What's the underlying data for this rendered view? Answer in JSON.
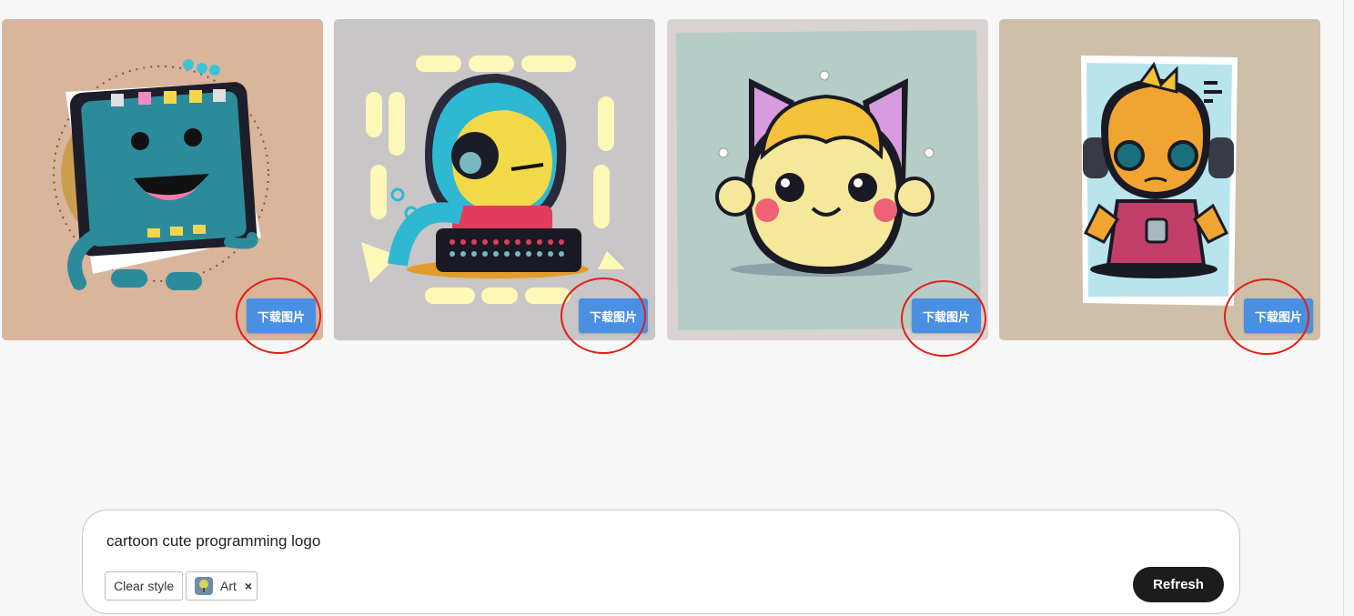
{
  "gallery": {
    "cards": [
      {
        "download_label": "下载图片",
        "bg": "#d9b59c"
      },
      {
        "download_label": "下载图片",
        "bg": "#c8c6c6"
      },
      {
        "download_label": "下载图片",
        "bg": "#d8d3d1"
      },
      {
        "download_label": "下载图片",
        "bg": "#cdbfa8"
      }
    ]
  },
  "prompt": {
    "text": "cartoon cute programming logo",
    "clear_style_label": "Clear style",
    "style_chip_label": "Art",
    "style_chip_remove": "×",
    "refresh_label": "Refresh"
  },
  "colors": {
    "download_button": "#4a90e2",
    "annotation_circle": "#e21f17",
    "refresh_button": "#1c1c1c"
  }
}
